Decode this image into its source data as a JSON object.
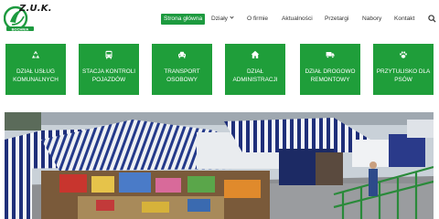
{
  "logo": {
    "text": "Z.U.K.",
    "brand_color": "#1d9a3f"
  },
  "nav": {
    "items": [
      {
        "label": "Strona główna",
        "active": true
      },
      {
        "label": "Działy",
        "dropdown": true
      },
      {
        "label": "O firmie"
      },
      {
        "label": "Aktualności"
      },
      {
        "label": "Przetargi"
      },
      {
        "label": "Nabory"
      },
      {
        "label": "Kontakt"
      }
    ],
    "search_icon": "search-icon"
  },
  "tiles": [
    {
      "icon": "recycle-icon",
      "label": "DZIAŁ USŁUG KOMUNALNYCH"
    },
    {
      "icon": "bus-icon",
      "label": "STACJA KONTROLI POJAZDÓW"
    },
    {
      "icon": "car-icon",
      "label": "TRANSPORT OSOBOWY"
    },
    {
      "icon": "home-icon",
      "label": "DZIAŁ ADMINISTRACJI"
    },
    {
      "icon": "truck-icon",
      "label": "DZIAŁ DROGOWO REMONTOWY"
    },
    {
      "icon": "paw-icon",
      "label": "PRZYTULISKO DLA PSÓW"
    }
  ],
  "colors": {
    "accent": "#1d9a3f",
    "tile": "#1f9e3a"
  },
  "hero": {
    "description_icon": "market-photo"
  }
}
